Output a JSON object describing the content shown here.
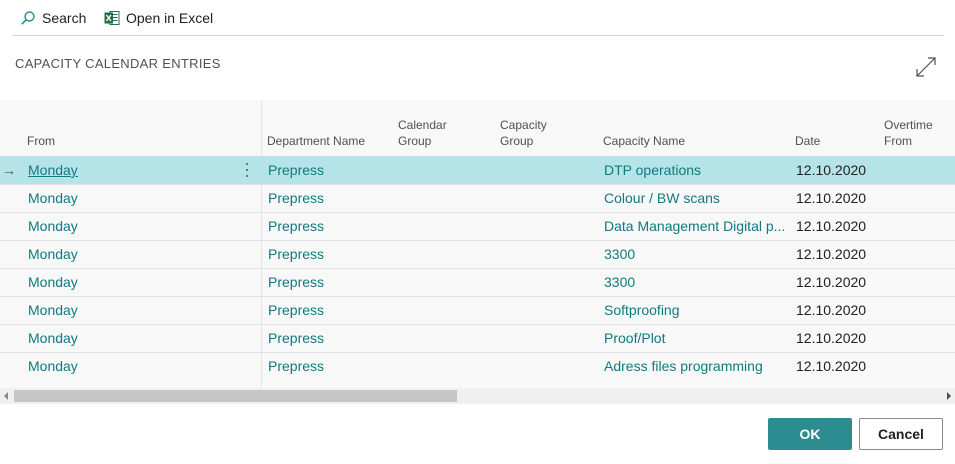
{
  "toolbar": {
    "search_label": "Search",
    "excel_label": "Open in Excel",
    "search_icon": "search-icon",
    "excel_icon": "excel-icon"
  },
  "page": {
    "title": "CAPACITY CALENDAR ENTRIES"
  },
  "grid": {
    "columns": [
      "From",
      "Department Name",
      "Calendar\nGroup",
      "Capacity\nGroup",
      "Capacity Name",
      "Date",
      "Overtime\nFrom"
    ],
    "selected_marker": "→",
    "rows": [
      {
        "from": "Monday",
        "department": "Prepress",
        "calendar_group": "",
        "capacity_group": "",
        "capacity_name": "DTP operations",
        "date": "12.10.2020",
        "overtime_from": ""
      },
      {
        "from": "Monday",
        "department": "Prepress",
        "calendar_group": "",
        "capacity_group": "",
        "capacity_name": "Colour / BW scans",
        "date": "12.10.2020",
        "overtime_from": ""
      },
      {
        "from": "Monday",
        "department": "Prepress",
        "calendar_group": "",
        "capacity_group": "",
        "capacity_name": "Data Management Digital p...",
        "date": "12.10.2020",
        "overtime_from": ""
      },
      {
        "from": "Monday",
        "department": "Prepress",
        "calendar_group": "",
        "capacity_group": "",
        "capacity_name": "3300",
        "date": "12.10.2020",
        "overtime_from": ""
      },
      {
        "from": "Monday",
        "department": "Prepress",
        "calendar_group": "",
        "capacity_group": "",
        "capacity_name": "3300",
        "date": "12.10.2020",
        "overtime_from": ""
      },
      {
        "from": "Monday",
        "department": "Prepress",
        "calendar_group": "",
        "capacity_group": "",
        "capacity_name": "Softproofing",
        "date": "12.10.2020",
        "overtime_from": ""
      },
      {
        "from": "Monday",
        "department": "Prepress",
        "calendar_group": "",
        "capacity_group": "",
        "capacity_name": "Proof/Plot",
        "date": "12.10.2020",
        "overtime_from": ""
      },
      {
        "from": "Monday",
        "department": "Prepress",
        "calendar_group": "",
        "capacity_group": "",
        "capacity_name": "Adress files programming",
        "date": "12.10.2020",
        "overtime_from": ""
      }
    ]
  },
  "footer": {
    "ok_label": "OK",
    "cancel_label": "Cancel"
  },
  "colors": {
    "accent": "#2d8c8f",
    "link": "#0f7a7f",
    "selected_row": "#b5e4e8"
  }
}
